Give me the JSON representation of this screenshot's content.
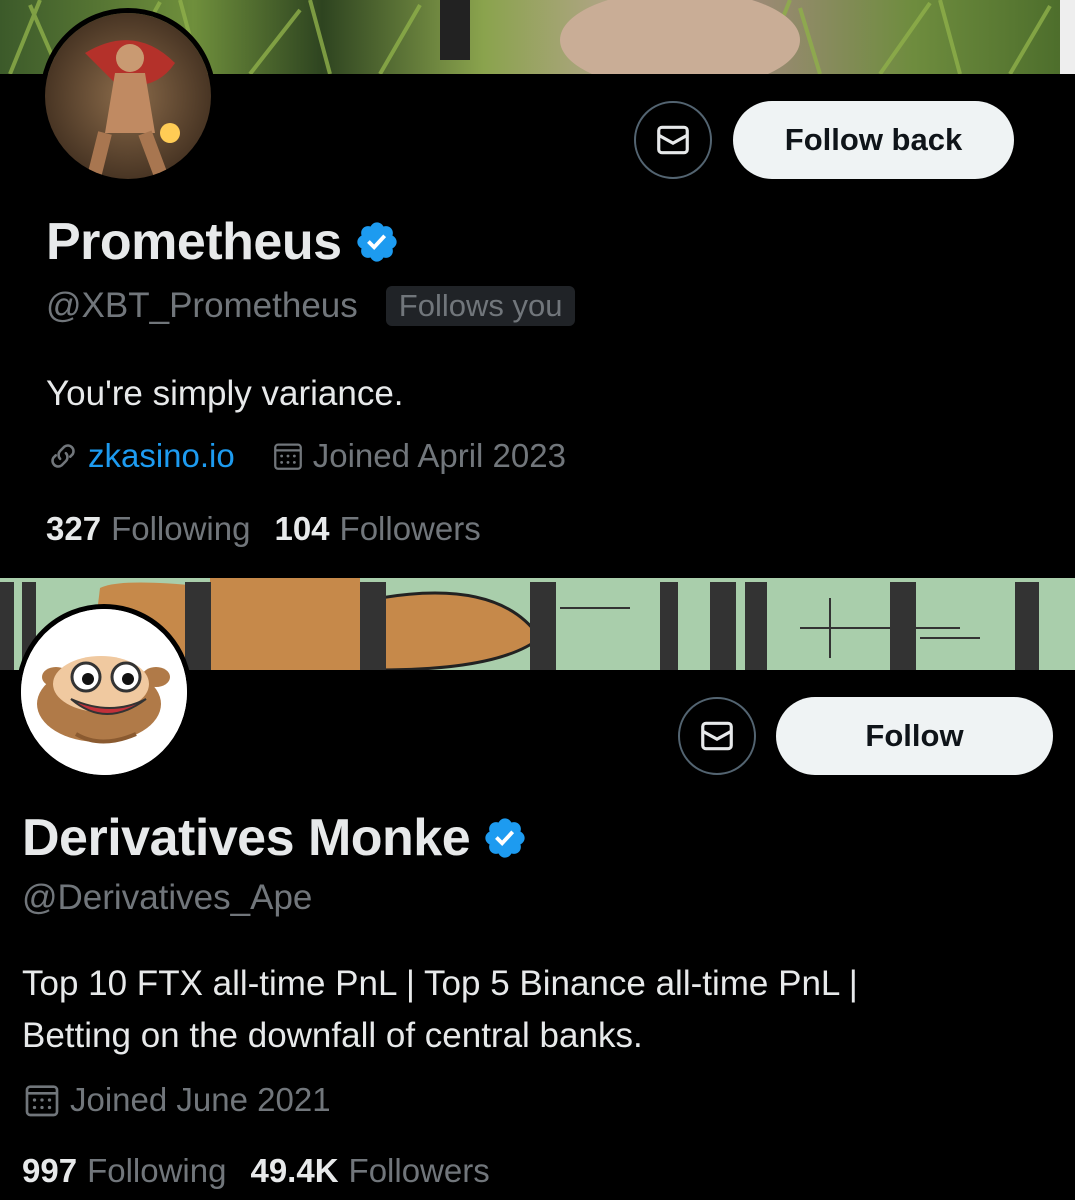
{
  "profiles": [
    {
      "display_name": "Prometheus",
      "handle": "@XBT_Prometheus",
      "follows_you_badge": "Follows you",
      "action_button": "Follow back",
      "bio": "You're simply variance.",
      "website": "zkasino.io",
      "joined": "Joined April 2023",
      "following_count": "327",
      "following_label": "Following",
      "followers_count": "104",
      "followers_label": "Followers"
    },
    {
      "display_name": "Derivatives Monke",
      "handle": "@Derivatives_Ape",
      "action_button": "Follow",
      "bio_line1": "Top 10 FTX all-time PnL | Top 5 Binance all-time PnL |",
      "bio_line2": "Betting on the downfall of central banks.",
      "joined": "Joined June 2021",
      "following_count": "997",
      "following_label": "Following",
      "followers_count": "49.4K",
      "followers_label": "Followers"
    }
  ],
  "colors": {
    "background": "#000000",
    "verified_blue": "#1d9bf0",
    "secondary_text": "#71767b",
    "button_bg": "#eff3f4"
  },
  "icons": {
    "message": "envelope-icon",
    "verified": "verified-badge-icon",
    "link": "link-icon",
    "calendar": "calendar-icon"
  }
}
